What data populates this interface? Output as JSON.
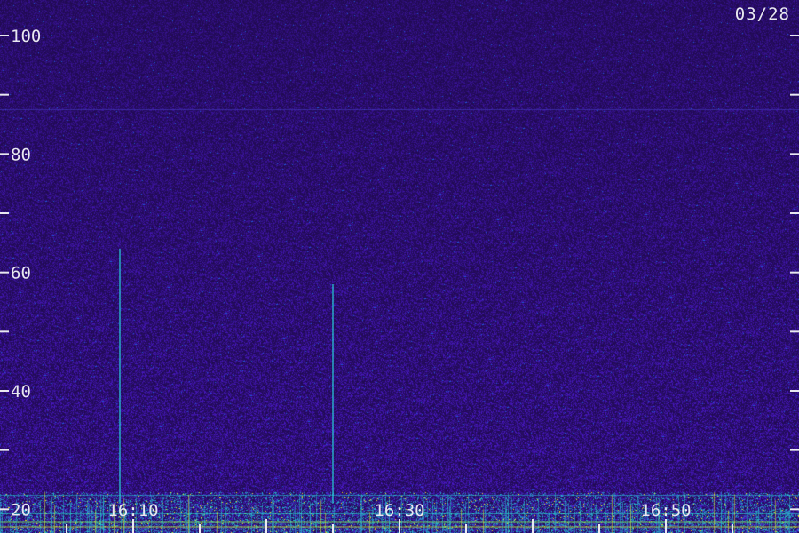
{
  "chart_data": {
    "type": "heatmap",
    "title": "",
    "xlabel": "",
    "ylabel": "",
    "date_label": "03/28",
    "x": {
      "start_time": "16:00",
      "end_time": "17:00",
      "major_tick_minutes": 10,
      "minor_tick_minutes": 5,
      "tick_labels": [
        "16:10",
        "16:30",
        "16:50"
      ]
    },
    "y": {
      "range": [
        16,
        106
      ],
      "major_tick_step": 20,
      "minor_tick_step": 10,
      "tick_labels": [
        "20",
        "40",
        "60",
        "80",
        "100"
      ]
    },
    "features": [
      {
        "kind": "vertical_streak",
        "time": "16:09",
        "freq_range": [
          21,
          64
        ]
      },
      {
        "kind": "vertical_streak",
        "time": "16:25",
        "freq_range": [
          21,
          58
        ]
      },
      {
        "kind": "horizontal_line",
        "freq": 87.5
      },
      {
        "kind": "horizontal_line",
        "freq": 22.5
      },
      {
        "kind": "low_band_activity",
        "freq_range": [
          16,
          23
        ]
      }
    ],
    "colors": {
      "background": "#200a50",
      "noise": "#3c14a0",
      "low_band": "#1ec8c8",
      "strong": "#f0e61e",
      "axis_text": "#e8e8f0"
    }
  }
}
